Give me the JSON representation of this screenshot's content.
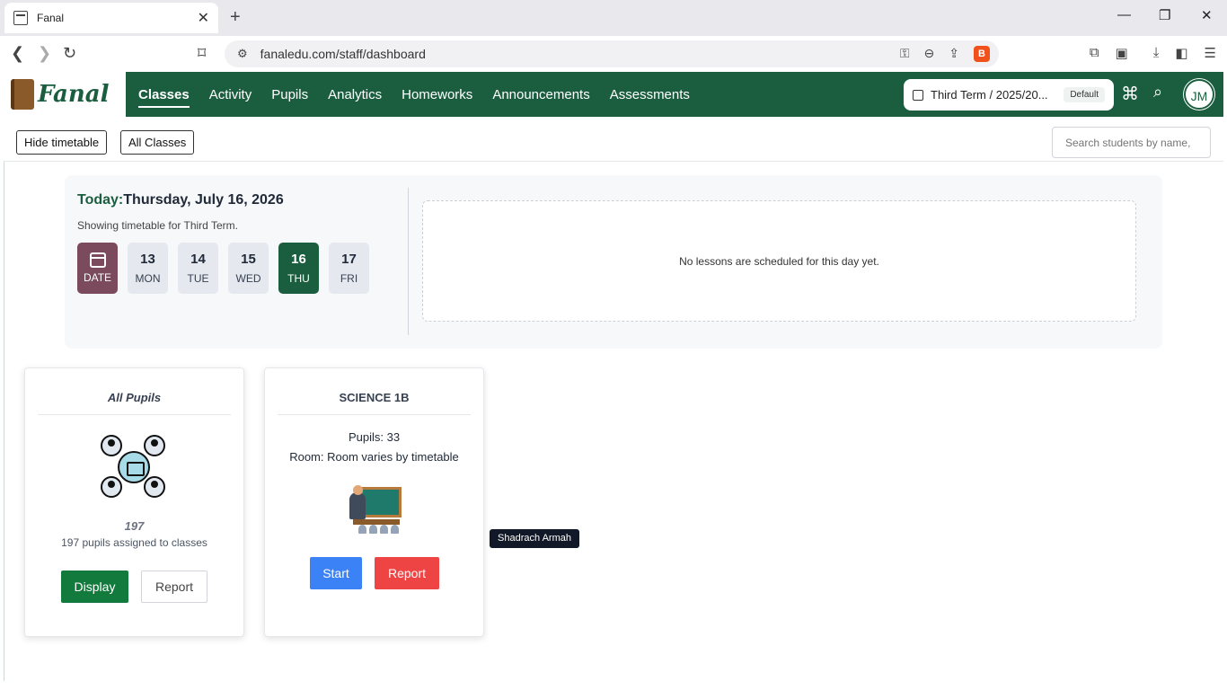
{
  "browser": {
    "tab_title": "Fanal",
    "url": "fanaledu.com/staff/dashboard"
  },
  "app": {
    "logo_text": "Fanal",
    "nav": [
      "Classes",
      "Activity",
      "Pupils",
      "Analytics",
      "Homeworks",
      "Announcements",
      "Assessments"
    ],
    "active_nav": "Classes",
    "term_label": "Third Term / 2025/20...",
    "term_badge": "Default",
    "user_initials": "JM",
    "brand_color": "#1b5e3f"
  },
  "toolbar": {
    "hide_timetable": "Hide timetable",
    "all_classes": "All Classes",
    "search_placeholder": "Search students by name,"
  },
  "timetable": {
    "today_label": "Today:",
    "today_date": "Thursday, July 16, 2026",
    "showing_text": "Showing timetable for Third Term.",
    "date_button": "DATE",
    "days": [
      {
        "num": "13",
        "name": "MON"
      },
      {
        "num": "14",
        "name": "TUE"
      },
      {
        "num": "15",
        "name": "WED"
      },
      {
        "num": "16",
        "name": "THU"
      },
      {
        "num": "17",
        "name": "FRI"
      }
    ],
    "selected_day": "16",
    "no_lessons": "No lessons are scheduled for this day yet."
  },
  "cards": {
    "all_pupils": {
      "title": "All Pupils",
      "count": "197",
      "subtitle": "197 pupils assigned to classes",
      "display_button": "Display",
      "report_button": "Report"
    },
    "science": {
      "title": "SCIENCE 1B",
      "pupils": "Pupils: 33",
      "room": "Room: Room varies by timetable",
      "start_button": "Start",
      "report_button": "Report"
    }
  },
  "tooltip": "Shadrach Armah"
}
